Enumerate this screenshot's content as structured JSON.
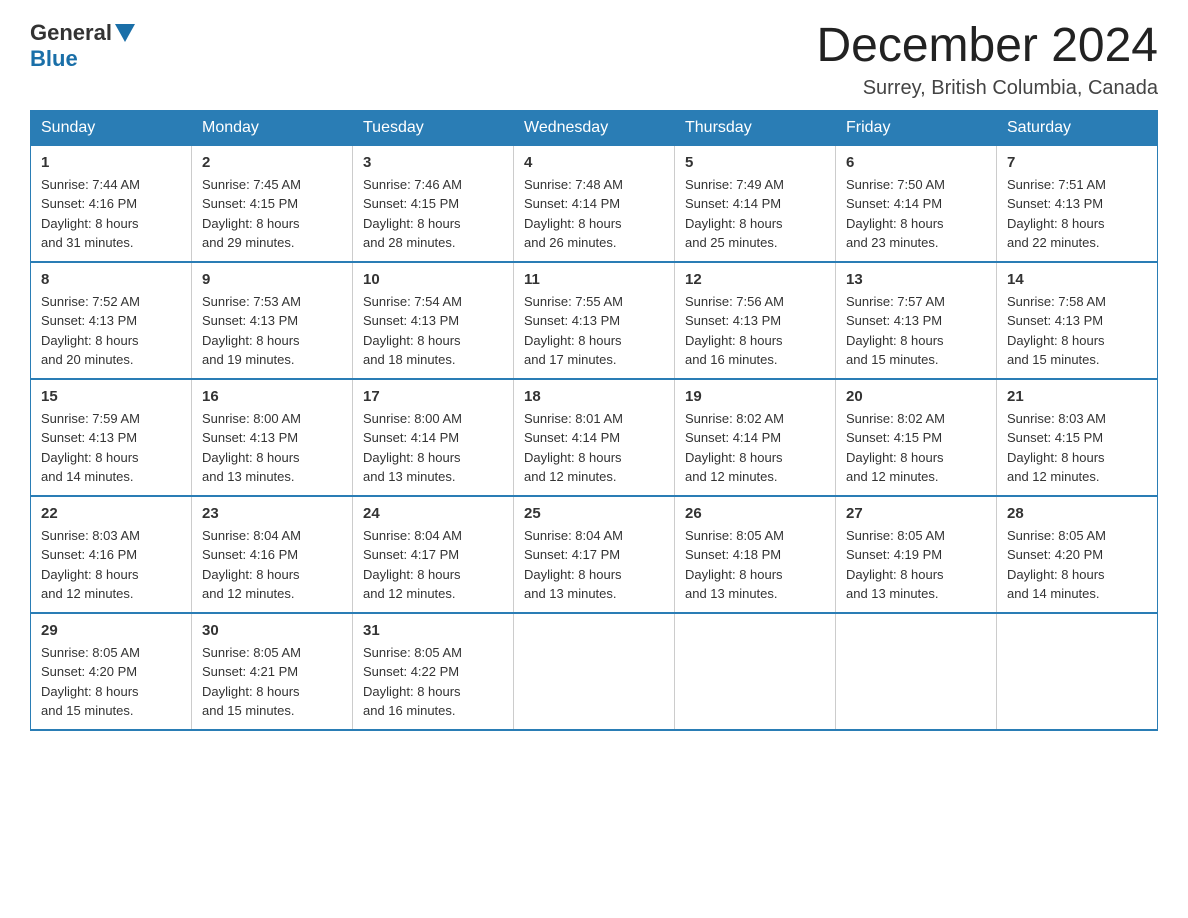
{
  "header": {
    "logo_general": "General",
    "logo_blue": "Blue",
    "month_year": "December 2024",
    "location": "Surrey, British Columbia, Canada"
  },
  "days_of_week": [
    "Sunday",
    "Monday",
    "Tuesday",
    "Wednesday",
    "Thursday",
    "Friday",
    "Saturday"
  ],
  "weeks": [
    [
      {
        "day": "1",
        "sunrise": "7:44 AM",
        "sunset": "4:16 PM",
        "daylight": "8 hours and 31 minutes."
      },
      {
        "day": "2",
        "sunrise": "7:45 AM",
        "sunset": "4:15 PM",
        "daylight": "8 hours and 29 minutes."
      },
      {
        "day": "3",
        "sunrise": "7:46 AM",
        "sunset": "4:15 PM",
        "daylight": "8 hours and 28 minutes."
      },
      {
        "day": "4",
        "sunrise": "7:48 AM",
        "sunset": "4:14 PM",
        "daylight": "8 hours and 26 minutes."
      },
      {
        "day": "5",
        "sunrise": "7:49 AM",
        "sunset": "4:14 PM",
        "daylight": "8 hours and 25 minutes."
      },
      {
        "day": "6",
        "sunrise": "7:50 AM",
        "sunset": "4:14 PM",
        "daylight": "8 hours and 23 minutes."
      },
      {
        "day": "7",
        "sunrise": "7:51 AM",
        "sunset": "4:13 PM",
        "daylight": "8 hours and 22 minutes."
      }
    ],
    [
      {
        "day": "8",
        "sunrise": "7:52 AM",
        "sunset": "4:13 PM",
        "daylight": "8 hours and 20 minutes."
      },
      {
        "day": "9",
        "sunrise": "7:53 AM",
        "sunset": "4:13 PM",
        "daylight": "8 hours and 19 minutes."
      },
      {
        "day": "10",
        "sunrise": "7:54 AM",
        "sunset": "4:13 PM",
        "daylight": "8 hours and 18 minutes."
      },
      {
        "day": "11",
        "sunrise": "7:55 AM",
        "sunset": "4:13 PM",
        "daylight": "8 hours and 17 minutes."
      },
      {
        "day": "12",
        "sunrise": "7:56 AM",
        "sunset": "4:13 PM",
        "daylight": "8 hours and 16 minutes."
      },
      {
        "day": "13",
        "sunrise": "7:57 AM",
        "sunset": "4:13 PM",
        "daylight": "8 hours and 15 minutes."
      },
      {
        "day": "14",
        "sunrise": "7:58 AM",
        "sunset": "4:13 PM",
        "daylight": "8 hours and 15 minutes."
      }
    ],
    [
      {
        "day": "15",
        "sunrise": "7:59 AM",
        "sunset": "4:13 PM",
        "daylight": "8 hours and 14 minutes."
      },
      {
        "day": "16",
        "sunrise": "8:00 AM",
        "sunset": "4:13 PM",
        "daylight": "8 hours and 13 minutes."
      },
      {
        "day": "17",
        "sunrise": "8:00 AM",
        "sunset": "4:14 PM",
        "daylight": "8 hours and 13 minutes."
      },
      {
        "day": "18",
        "sunrise": "8:01 AM",
        "sunset": "4:14 PM",
        "daylight": "8 hours and 12 minutes."
      },
      {
        "day": "19",
        "sunrise": "8:02 AM",
        "sunset": "4:14 PM",
        "daylight": "8 hours and 12 minutes."
      },
      {
        "day": "20",
        "sunrise": "8:02 AM",
        "sunset": "4:15 PM",
        "daylight": "8 hours and 12 minutes."
      },
      {
        "day": "21",
        "sunrise": "8:03 AM",
        "sunset": "4:15 PM",
        "daylight": "8 hours and 12 minutes."
      }
    ],
    [
      {
        "day": "22",
        "sunrise": "8:03 AM",
        "sunset": "4:16 PM",
        "daylight": "8 hours and 12 minutes."
      },
      {
        "day": "23",
        "sunrise": "8:04 AM",
        "sunset": "4:16 PM",
        "daylight": "8 hours and 12 minutes."
      },
      {
        "day": "24",
        "sunrise": "8:04 AM",
        "sunset": "4:17 PM",
        "daylight": "8 hours and 12 minutes."
      },
      {
        "day": "25",
        "sunrise": "8:04 AM",
        "sunset": "4:17 PM",
        "daylight": "8 hours and 13 minutes."
      },
      {
        "day": "26",
        "sunrise": "8:05 AM",
        "sunset": "4:18 PM",
        "daylight": "8 hours and 13 minutes."
      },
      {
        "day": "27",
        "sunrise": "8:05 AM",
        "sunset": "4:19 PM",
        "daylight": "8 hours and 13 minutes."
      },
      {
        "day": "28",
        "sunrise": "8:05 AM",
        "sunset": "4:20 PM",
        "daylight": "8 hours and 14 minutes."
      }
    ],
    [
      {
        "day": "29",
        "sunrise": "8:05 AM",
        "sunset": "4:20 PM",
        "daylight": "8 hours and 15 minutes."
      },
      {
        "day": "30",
        "sunrise": "8:05 AM",
        "sunset": "4:21 PM",
        "daylight": "8 hours and 15 minutes."
      },
      {
        "day": "31",
        "sunrise": "8:05 AM",
        "sunset": "4:22 PM",
        "daylight": "8 hours and 16 minutes."
      },
      null,
      null,
      null,
      null
    ]
  ],
  "labels": {
    "sunrise": "Sunrise:",
    "sunset": "Sunset:",
    "daylight": "Daylight:"
  }
}
